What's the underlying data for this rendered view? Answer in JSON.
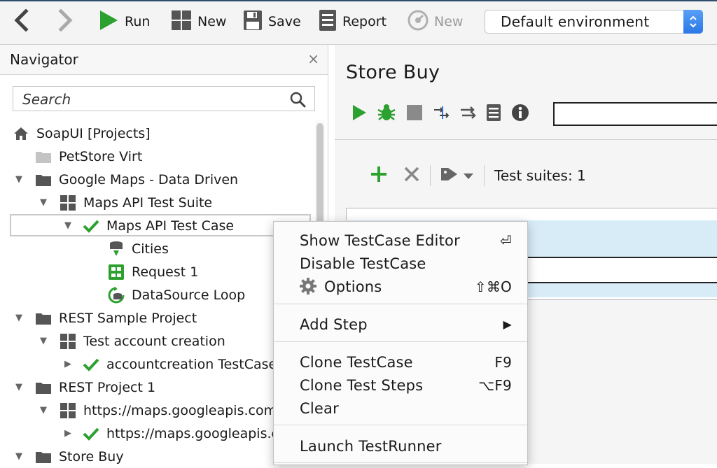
{
  "toolbar": {
    "run_label": "Run",
    "new_label": "New",
    "save_label": "Save",
    "report_label": "Report",
    "new_disabled_label": "New",
    "environment": "Default environment"
  },
  "navigator": {
    "title": "Navigator",
    "close_glyph": "×",
    "search_placeholder": "Search",
    "items": [
      {
        "label": "SoapUI [Projects]",
        "icon": "home-icon"
      },
      {
        "label": "PetStore Virt",
        "icon": "folder-icon"
      },
      {
        "label": "Google Maps - Data Driven",
        "icon": "folder-icon"
      },
      {
        "label": "Maps API Test Suite",
        "icon": "test-suite-icon"
      },
      {
        "label": "Maps API Test Case",
        "icon": "check-icon"
      },
      {
        "label": "Cities",
        "icon": "datasource-icon"
      },
      {
        "label": "Request 1",
        "icon": "rest-request-icon"
      },
      {
        "label": "DataSource Loop",
        "icon": "datasource-loop-icon"
      },
      {
        "label": "REST Sample Project",
        "icon": "folder-icon"
      },
      {
        "label": "Test account creation",
        "icon": "test-suite-icon"
      },
      {
        "label": "accountcreation TestCase",
        "icon": "check-icon"
      },
      {
        "label": "REST Project 1",
        "icon": "folder-icon"
      },
      {
        "label": "https://maps.googleapis.com",
        "icon": "test-suite-icon"
      },
      {
        "label": "https://maps.googleapis.com",
        "icon": "check-icon"
      },
      {
        "label": "Store Buy",
        "icon": "folder-icon"
      }
    ]
  },
  "main": {
    "title": "Store Buy",
    "suites_label": "Test suites: 1"
  },
  "context_menu": {
    "items": [
      {
        "label": "Show TestCase Editor",
        "shortcut": "⏎"
      },
      {
        "label": "Disable TestCase",
        "shortcut": ""
      },
      {
        "label": "Options",
        "shortcut": "⇧⌘O"
      },
      {
        "label": "Add Step",
        "shortcut": "▶"
      },
      {
        "label": "Clone TestCase",
        "shortcut": "F9"
      },
      {
        "label": "Clone Test Steps",
        "shortcut": "⌥F9"
      },
      {
        "label": "Clear",
        "shortcut": ""
      },
      {
        "label": "Launch TestRunner",
        "shortcut": ""
      }
    ]
  },
  "colors": {
    "accent_green": "#2ca12f",
    "select_blue": "#2a77e6",
    "folder_gray": "#555555"
  }
}
